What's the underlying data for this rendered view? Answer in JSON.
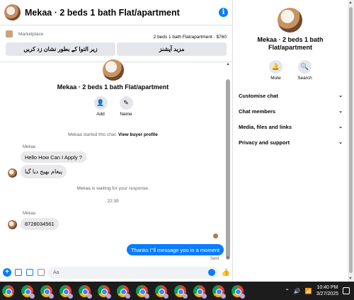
{
  "header": {
    "title": "Mekaa · 2 beds 1 bath Flat/apartment"
  },
  "marketplace": {
    "label": "Marketplace",
    "listing": "2 beds 1 bath Flat/apartment · $760",
    "button_left": "زیر التوا کے بطور نشان زد کریں",
    "button_right": "مزید آپشنز"
  },
  "profile": {
    "name": "Mekaa · 2 beds 1 bath Flat/apartment",
    "actions": [
      "Add",
      "Name"
    ]
  },
  "messages": {
    "system_start_prefix": "Mekaa started this chat.",
    "system_start_link": "View buyer profile",
    "sender_1": "Mekaa",
    "msg_1": "Hello How Can I Apply ?",
    "msg_2": "پیغام بھیج دیا گیا",
    "system_waiting": "Mekaa is waiting for your response.",
    "timestamp": "22:39",
    "sender_2": "Mekaa",
    "msg_3": "8728034561",
    "msg_mine": "Thanks I''ll message you in a moment",
    "sent_status": "Sent"
  },
  "composer": {
    "placeholder": "Aa"
  },
  "info_panel": {
    "title_line1": "Mekaa · 2 beds 1 bath",
    "title_line2": "Flat/apartment",
    "mute_label": "Mute",
    "search_label": "Search",
    "menu": [
      {
        "label": "Customise chat"
      },
      {
        "label": "Chat members"
      },
      {
        "label": "Media, files and links"
      },
      {
        "label": "Privacy and support"
      }
    ]
  },
  "taskbar": {
    "time": "10:40 PM",
    "date": "3/27/2025"
  },
  "colors": {
    "accent": "#0a7cff",
    "bubble_gray": "#e9e9eb",
    "button_gray": "#e4e6eb",
    "taskbar": "#1c1c1c"
  }
}
